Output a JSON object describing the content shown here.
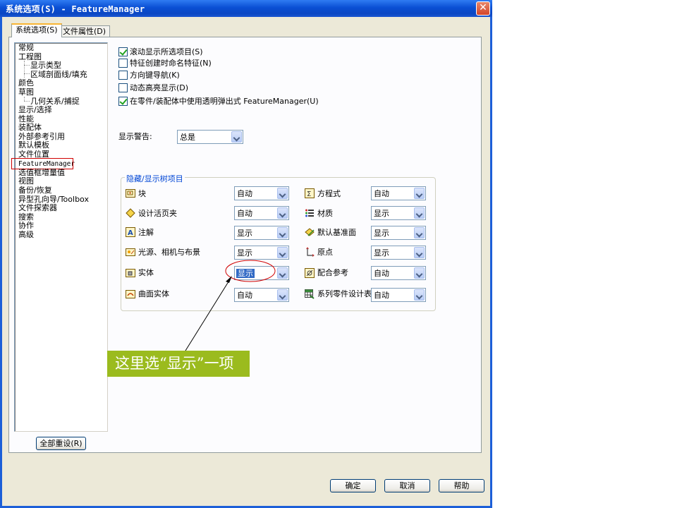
{
  "window": {
    "title": "系统选项(S) - FeatureManager",
    "close": "✕"
  },
  "tabs": [
    {
      "label": "系统选项(S)",
      "active": true
    },
    {
      "label": "文件属性(D)",
      "active": false
    }
  ],
  "tree": {
    "items": [
      "常规",
      "工程图",
      "显示类型",
      "区域剖面线/填充",
      "颜色",
      "草图",
      "几何关系/捕捉",
      "显示/选择",
      "性能",
      "装配体",
      "外部参考引用",
      "默认模板",
      "文件位置",
      "FeatureManager",
      "选值框增量值",
      "视图",
      "备份/恢复",
      "异型孔向导/Toolbox",
      "文件探索器",
      "搜索",
      "协作",
      "高级"
    ],
    "selected": "FeatureManager"
  },
  "options": {
    "checkboxes": [
      {
        "label": "滚动显示所选项目(S)",
        "checked": true
      },
      {
        "label": "特征创建时命名特征(N)",
        "checked": false
      },
      {
        "label": "方向键导航(K)",
        "checked": false
      },
      {
        "label": "动态高亮显示(D)",
        "checked": false
      },
      {
        "label": "在零件/装配体中使用透明弹出式 FeatureManager(U)",
        "checked": true
      }
    ],
    "warning_label": "显示警告:",
    "warning_value": "总是"
  },
  "tree_items_group": {
    "title": "隐藏/显示树项目",
    "left": [
      {
        "label": "块",
        "value": "自动",
        "icon": "block-icon"
      },
      {
        "label": "设计活页夹",
        "value": "自动",
        "icon": "design-binder-icon"
      },
      {
        "label": "注解",
        "value": "显示",
        "icon": "annotation-icon"
      },
      {
        "label": "光源、相机与布景",
        "value": "显示",
        "icon": "lights-cameras-icon"
      },
      {
        "label": "实体",
        "value": "显示",
        "icon": "solid-body-icon",
        "highlighted": true
      },
      {
        "label": "曲面实体",
        "value": "自动",
        "icon": "surface-body-icon"
      }
    ],
    "right": [
      {
        "label": "方程式",
        "value": "自动",
        "icon": "equation-icon"
      },
      {
        "label": "材质",
        "value": "显示",
        "icon": "material-icon"
      },
      {
        "label": "默认基准面",
        "value": "显示",
        "icon": "default-plane-icon"
      },
      {
        "label": "原点",
        "value": "显示",
        "icon": "origin-icon"
      },
      {
        "label": "配合参考",
        "value": "自动",
        "icon": "mate-reference-icon"
      },
      {
        "label": "系列零件设计表",
        "value": "自动",
        "icon": "design-table-icon"
      }
    ]
  },
  "buttons": {
    "reset": "全部重设(R)",
    "ok": "确定",
    "cancel": "取消",
    "help": "帮助"
  },
  "callout": {
    "text": "这里选“显示”一项"
  },
  "colors": {
    "accent": "#0046d5",
    "callout_bg": "#9bbb1e",
    "highlight": "#d00000"
  }
}
